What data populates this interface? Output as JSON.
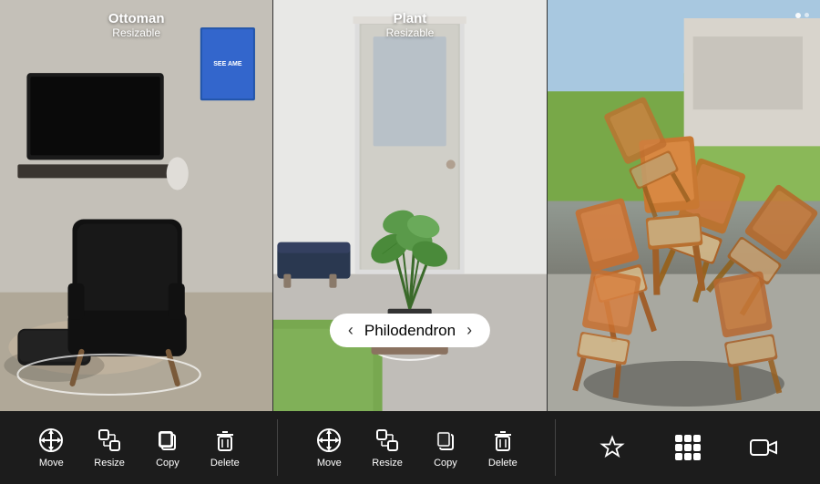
{
  "panels": [
    {
      "id": "panel-1",
      "item_name": "Ottoman",
      "item_subtitle": "Resizable",
      "bg_desc": "living room with TV and chair"
    },
    {
      "id": "panel-2",
      "item_name": "Plant",
      "item_subtitle": "Resizable",
      "selector_label": "Philodendron",
      "selector_prev": "‹",
      "selector_next": "›",
      "bg_desc": "entryway with door"
    },
    {
      "id": "panel-3",
      "bg_desc": "outdoor patio with chairs"
    }
  ],
  "toolbar": {
    "sections": [
      {
        "id": "left",
        "buttons": [
          {
            "id": "move-1",
            "label": "Move",
            "icon": "move"
          },
          {
            "id": "resize-1",
            "label": "Resize",
            "icon": "resize"
          },
          {
            "id": "copy-1",
            "label": "Copy",
            "icon": "copy"
          },
          {
            "id": "delete-1",
            "label": "Delete",
            "icon": "delete"
          }
        ]
      },
      {
        "id": "middle",
        "buttons": [
          {
            "id": "move-2",
            "label": "Move",
            "icon": "move"
          },
          {
            "id": "resize-2",
            "label": "Resize",
            "icon": "resize"
          },
          {
            "id": "copy-2",
            "label": "Copy",
            "icon": "copy"
          },
          {
            "id": "delete-2",
            "label": "Delete",
            "icon": "delete"
          }
        ]
      },
      {
        "id": "right",
        "buttons": [
          {
            "id": "star",
            "label": "",
            "icon": "star"
          },
          {
            "id": "grid",
            "label": "",
            "icon": "grid"
          },
          {
            "id": "video",
            "label": "",
            "icon": "video"
          }
        ]
      }
    ]
  }
}
